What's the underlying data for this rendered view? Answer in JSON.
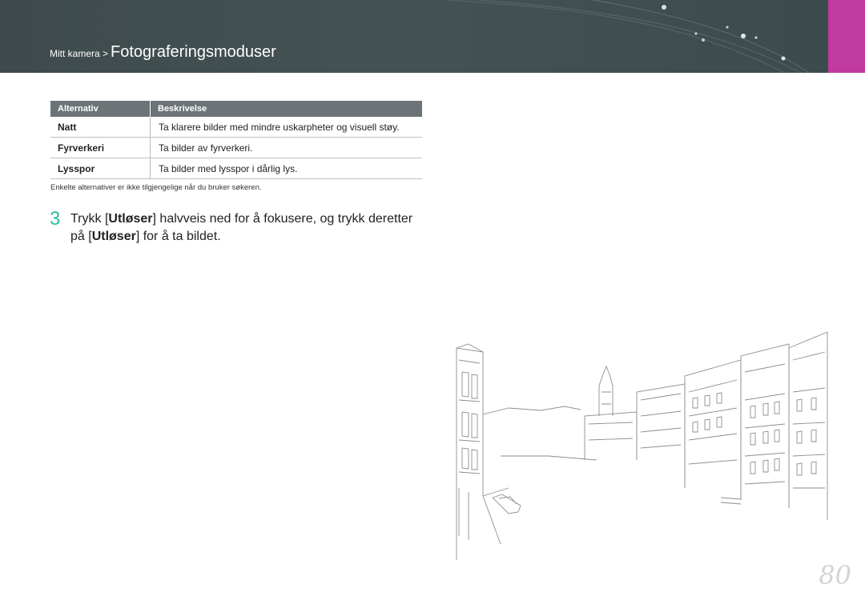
{
  "header": {
    "breadcrumb_parent": "Mitt kamera >",
    "breadcrumb_current": "Fotograferingsmoduser",
    "accent_color": "#c03aa0"
  },
  "table": {
    "headers": [
      "Alternativ",
      "Beskrivelse"
    ],
    "rows": [
      {
        "option": "Natt",
        "description": "Ta klarere bilder med mindre uskarpheter og visuell støy."
      },
      {
        "option": "Fyrverkeri",
        "description": "Ta bilder av fyrverkeri."
      },
      {
        "option": "Lysspor",
        "description": "Ta bilder med lysspor i dårlig lys."
      }
    ]
  },
  "note": "Enkelte alternativer er ikke tilgjengelige når du bruker søkeren.",
  "step": {
    "number": "3",
    "part1": "Trykk [",
    "button1": "Utløser",
    "part2": "] halvveis ned for å fokusere, og trykk deretter på [",
    "button2": "Utløser",
    "part3": "] for å ta bildet.",
    "number_color": "#2dbd9d"
  },
  "page_number": "80"
}
